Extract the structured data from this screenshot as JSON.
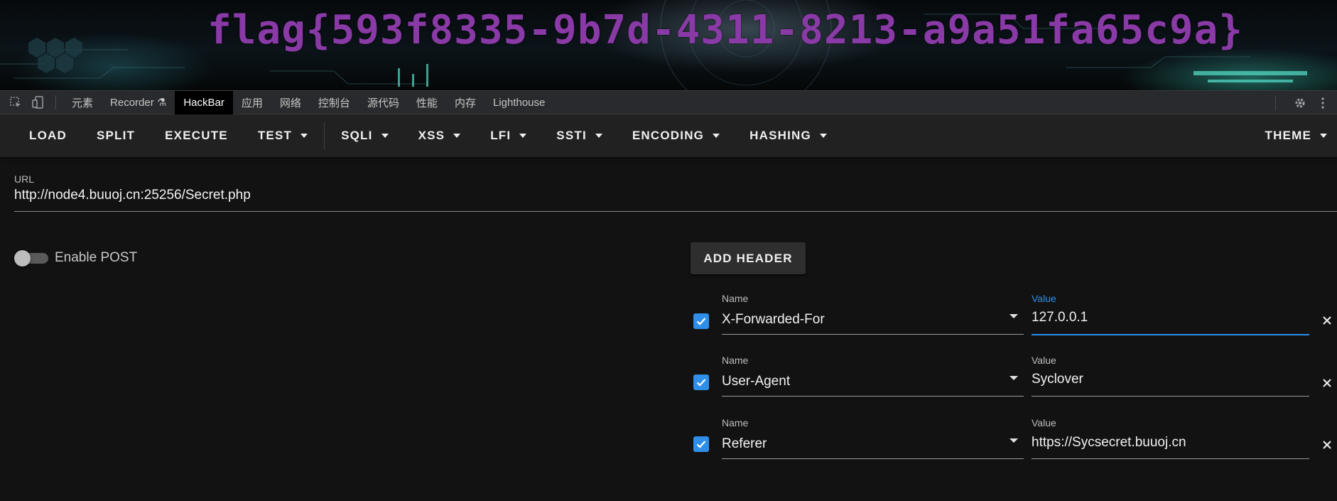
{
  "banner": {
    "flag_text": "flag{593f8335-9b7d-4311-8213-a9a51fa65c9a}"
  },
  "devtools": {
    "tabs": [
      {
        "label": "元素"
      },
      {
        "label": "Recorder ⚗"
      },
      {
        "label": "HackBar"
      },
      {
        "label": "应用"
      },
      {
        "label": "网络"
      },
      {
        "label": "控制台"
      },
      {
        "label": "源代码"
      },
      {
        "label": "性能"
      },
      {
        "label": "内存"
      },
      {
        "label": "Lighthouse"
      }
    ],
    "active_tab": "HackBar"
  },
  "toolbar": {
    "load": "LOAD",
    "split": "SPLIT",
    "execute": "EXECUTE",
    "test": "TEST",
    "sqli": "SQLI",
    "xss": "XSS",
    "lfi": "LFI",
    "ssti": "SSTI",
    "encoding": "ENCODING",
    "hashing": "HASHING",
    "theme": "THEME"
  },
  "url": {
    "label": "URL",
    "value": "http://node4.buuoj.cn:25256/Secret.php"
  },
  "post": {
    "label": "Enable POST",
    "enabled": false
  },
  "headers": {
    "add_label": "ADD HEADER",
    "name_label": "Name",
    "value_label": "Value",
    "rows": [
      {
        "name": "X-Forwarded-For",
        "value": "127.0.0.1",
        "enabled": true,
        "focused": true
      },
      {
        "name": "User-Agent",
        "value": "Syclover",
        "enabled": true,
        "focused": false
      },
      {
        "name": "Referer",
        "value": "https://Sycsecret.buuoj.cn",
        "enabled": true,
        "focused": false
      }
    ]
  },
  "colors": {
    "flag": "#8a3aa6",
    "accent": "#2f8fe8",
    "background": "#121212",
    "toolbar": "#212121"
  }
}
